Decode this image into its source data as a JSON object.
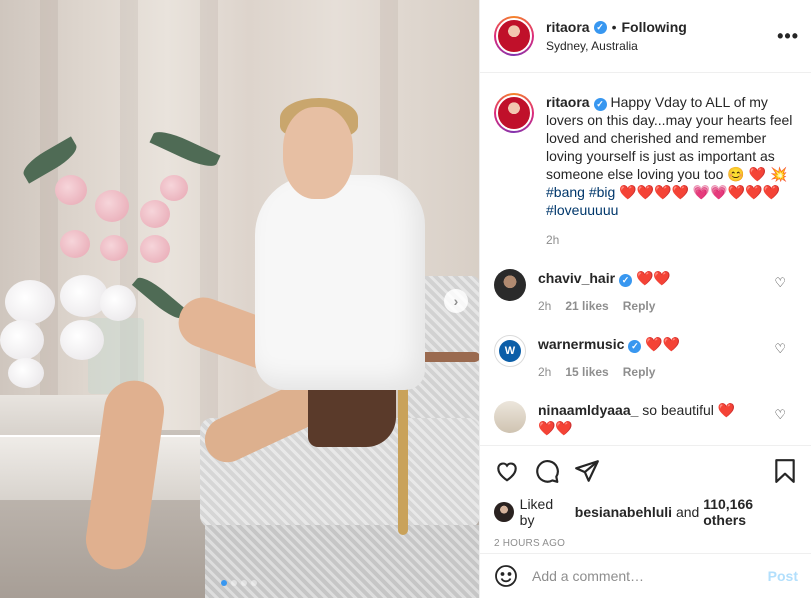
{
  "header": {
    "username": "ritaora",
    "separator": "•",
    "follow_status": "Following",
    "location": "Sydney, Australia"
  },
  "caption": {
    "username": "ritaora",
    "text": "Happy Vday to ALL of my lovers on this day...may your hearts feel loved and cherished and remember loving yourself is just as important as someone else loving you too 😊 ❤️ 💥",
    "hashtag_1": "#bang",
    "hashtag_2": "#big",
    "hearts_1": "❤️❤️❤️❤️",
    "hearts_2": "💗💗❤️❤️❤️",
    "hashtag_3": "#loveuuuuu",
    "time": "2h"
  },
  "comments": [
    {
      "username": "chaviv_hair",
      "verified": true,
      "text": "❤️❤️",
      "time": "2h",
      "likes": "21 likes",
      "reply": "Reply"
    },
    {
      "username": "warnermusic",
      "verified": true,
      "text": "❤️❤️",
      "time": "2h",
      "likes": "15 likes",
      "reply": "Reply"
    },
    {
      "username": "ninaamldyaaa_",
      "verified": false,
      "text": "so beautiful ❤️",
      "text_2": "❤️❤️"
    }
  ],
  "likes": {
    "prefix": "Liked by",
    "user": "besianabehluli",
    "and": "and",
    "others": "110,166 others"
  },
  "posted_ago": "2 HOURS AGO",
  "add_comment": {
    "placeholder": "Add a comment…",
    "post_label": "Post"
  },
  "carousel": {
    "slides": 4,
    "active_index": 0
  },
  "colors": {
    "accent": "#3897f0",
    "heart": "#e0102a",
    "hashtag": "#00376b",
    "muted": "#8e8e8e",
    "post_disabled": "#b2dffc"
  },
  "icons": [
    "heart-icon",
    "comment-icon",
    "share-icon",
    "bookmark-icon",
    "emoji-icon",
    "more-options-icon",
    "verified-icon",
    "chevron-right-icon"
  ]
}
